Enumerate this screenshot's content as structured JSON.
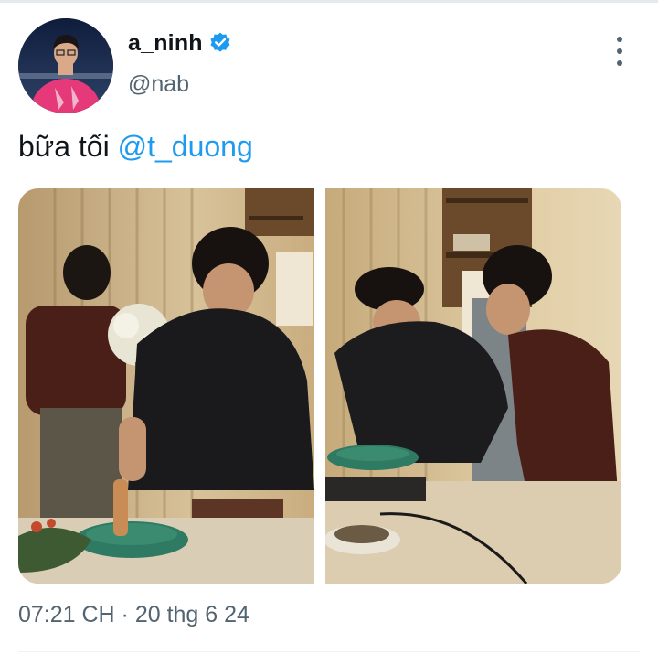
{
  "author": {
    "display_name": "a_ninh",
    "handle": "@nab",
    "verified": true,
    "avatar_icon": "profile-avatar"
  },
  "menu": {
    "icon": "more-vertical-icon"
  },
  "tweet": {
    "text": "bữa tối ",
    "mention": "@t_duong"
  },
  "media": [
    {
      "icon": "photo-cooking-scene-1"
    },
    {
      "icon": "photo-cooking-scene-2"
    }
  ],
  "meta": {
    "timestamp": "07:21 CH · 20 thg 6 24"
  },
  "colors": {
    "link": "#1d9bf0",
    "secondary_text": "#536471",
    "verified_badge": "#1d9bf0"
  }
}
